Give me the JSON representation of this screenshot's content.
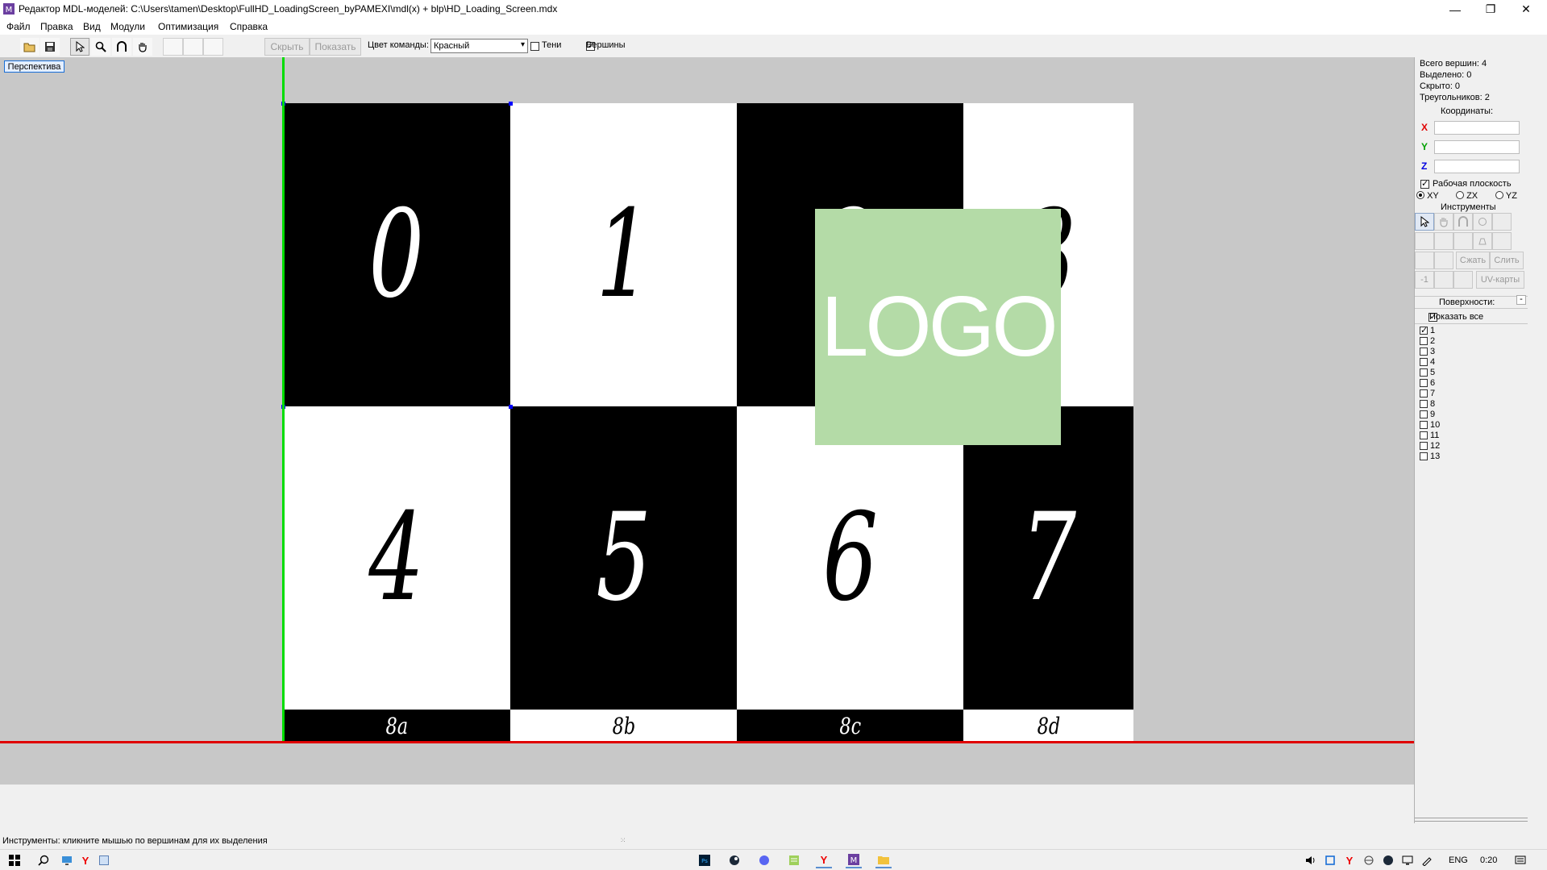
{
  "window": {
    "title": "Редактор MDL-моделей: C:\\Users\\tamen\\Desktop\\FullHD_LoadingScreen_byPAMEXI\\mdl(x) + blp\\HD_Loading_Screen.mdx",
    "minimize": "—",
    "maximize": "❐",
    "close": "✕"
  },
  "menu": [
    "Файл",
    "Правка",
    "Вид",
    "Модули",
    "Оптимизация",
    "Справка"
  ],
  "toolbar": {
    "hide_label": "Скрыть",
    "show_label": "Показать",
    "team_color_label": "Цвет команды:",
    "team_color_value": "Красный",
    "shadows_label": "Тени",
    "shadows_checked": false,
    "vertices_label": "Вершины",
    "vertices_checked": true
  },
  "viewport": {
    "view_tab": "Перспектива",
    "texture_digits": [
      "0",
      "1",
      "2",
      "3",
      "4",
      "5",
      "6",
      "7"
    ],
    "bottom_labels": [
      "8a",
      "8b",
      "8c",
      "8d"
    ],
    "logo_text": "LOGO",
    "logo_color": "#b4dba7"
  },
  "panel": {
    "total_vertices": "Всего вершин: 4",
    "selected": "Выделено: 0",
    "hidden": "Скрыто: 0",
    "triangles": "Треугольников: 2",
    "coordinates_title": "Координаты:",
    "x_label": "X",
    "y_label": "Y",
    "z_label": "Z",
    "x_color": "#e00000",
    "y_color": "#00a000",
    "z_color": "#0000e0",
    "workplane_label": "Рабочая плоскость",
    "workplane_checked": true,
    "plane_xy": "XY",
    "plane_zx": "ZX",
    "plane_yz": "YZ",
    "tools_title": "Инструменты",
    "compress_label": "Сжать",
    "merge_label": "Слить",
    "minus_one_label": "-1",
    "uv_label": "UV-карты",
    "surfaces_title": "Поверхности:",
    "surfaces_collapse": "-",
    "show_all_label": "Показать все",
    "show_all_checked": true,
    "surfaces": [
      {
        "label": "1",
        "checked": true
      },
      {
        "label": "2",
        "checked": false
      },
      {
        "label": "3",
        "checked": false
      },
      {
        "label": "4",
        "checked": false
      },
      {
        "label": "5",
        "checked": false
      },
      {
        "label": "6",
        "checked": false
      },
      {
        "label": "7",
        "checked": false
      },
      {
        "label": "8",
        "checked": false
      },
      {
        "label": "9",
        "checked": false
      },
      {
        "label": "10",
        "checked": false
      },
      {
        "label": "11",
        "checked": false
      },
      {
        "label": "12",
        "checked": false
      },
      {
        "label": "13",
        "checked": false
      }
    ]
  },
  "status": {
    "text": "Инструменты: кликните мышью по вершинам для их выделения"
  },
  "taskbar": {
    "language": "ENG",
    "time": "0:20"
  }
}
